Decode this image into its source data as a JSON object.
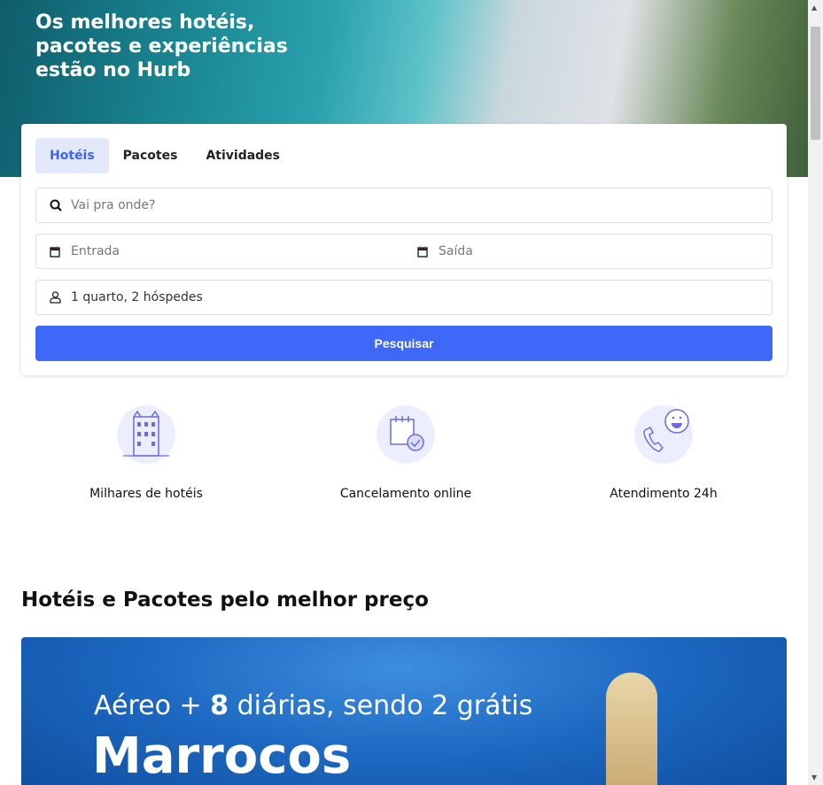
{
  "hero": {
    "title": "Os melhores hotéis, pacotes e experiências estão no Hurb"
  },
  "search": {
    "tabs": [
      {
        "label": "Hotéis",
        "active": true
      },
      {
        "label": "Pacotes"
      },
      {
        "label": "Atividades"
      }
    ],
    "destination_placeholder": "Vai pra onde?",
    "checkin_placeholder": "Entrada",
    "checkout_placeholder": "Saída",
    "guests_value": "1 quarto, 2 hóspedes",
    "submit_label": "Pesquisar"
  },
  "features": [
    {
      "label": "Milhares de hotéis",
      "icon": "hotel-icon"
    },
    {
      "label": "Cancelamento online",
      "icon": "calendar-check-icon"
    },
    {
      "label": "Atendimento 24h",
      "icon": "phone-chat-icon"
    }
  ],
  "section": {
    "title": "Hotéis e Pacotes pelo melhor preço"
  },
  "banner": {
    "prefix": "Aéreo + ",
    "bold": "8",
    "suffix": " diárias, sendo 2 grátis",
    "destination": "Marrocos"
  },
  "colors": {
    "accent": "#3d68f8",
    "tab_active_bg": "#e2e9fd"
  }
}
